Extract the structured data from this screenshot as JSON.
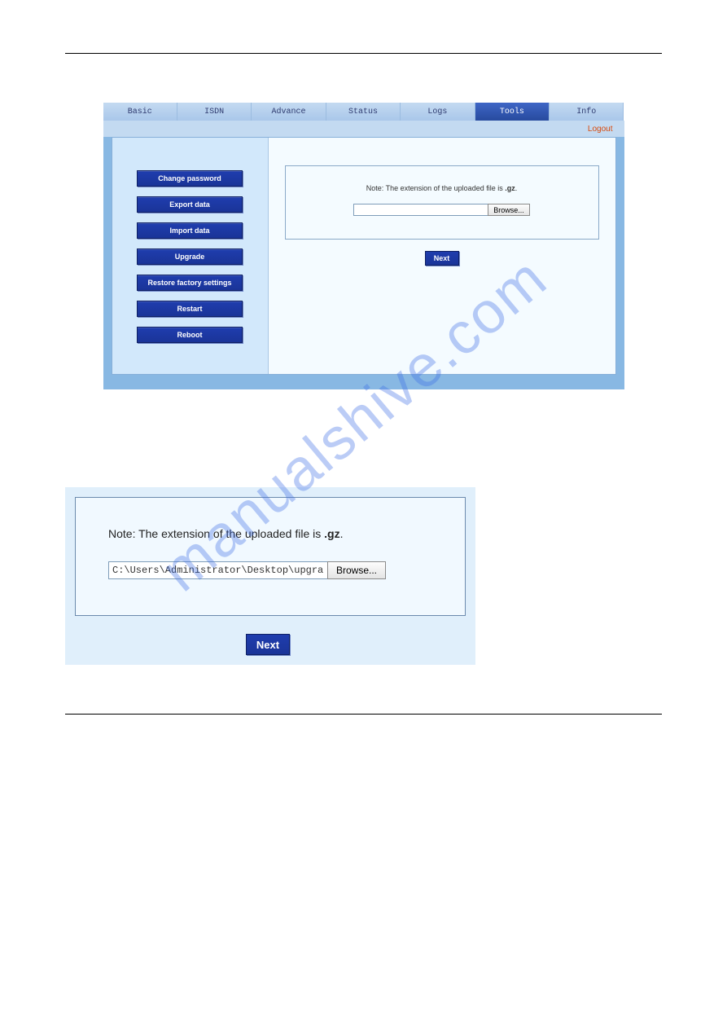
{
  "tabs": [
    "Basic",
    "ISDN",
    "Advance",
    "Status",
    "Logs",
    "Tools",
    "Info"
  ],
  "active_tab_index": 5,
  "logout": "Logout",
  "sidebar": {
    "items": [
      "Change password",
      "Export data",
      "Import data",
      "Upgrade",
      "Restore factory settings",
      "Restart",
      "Reboot"
    ]
  },
  "upload1": {
    "note_prefix": "Note: The extension of the uploaded file is ",
    "note_ext": ".gz",
    "note_suffix": ".",
    "value": "",
    "browse": "Browse...",
    "next": "Next"
  },
  "upload2": {
    "note_prefix": "Note: The extension of the uploaded file is ",
    "note_ext": ".gz",
    "note_suffix": ".",
    "value": "C:\\Users\\Administrator\\Desktop\\upgrad",
    "browse": "Browse...",
    "next": "Next"
  },
  "watermark": "manualshive.com"
}
